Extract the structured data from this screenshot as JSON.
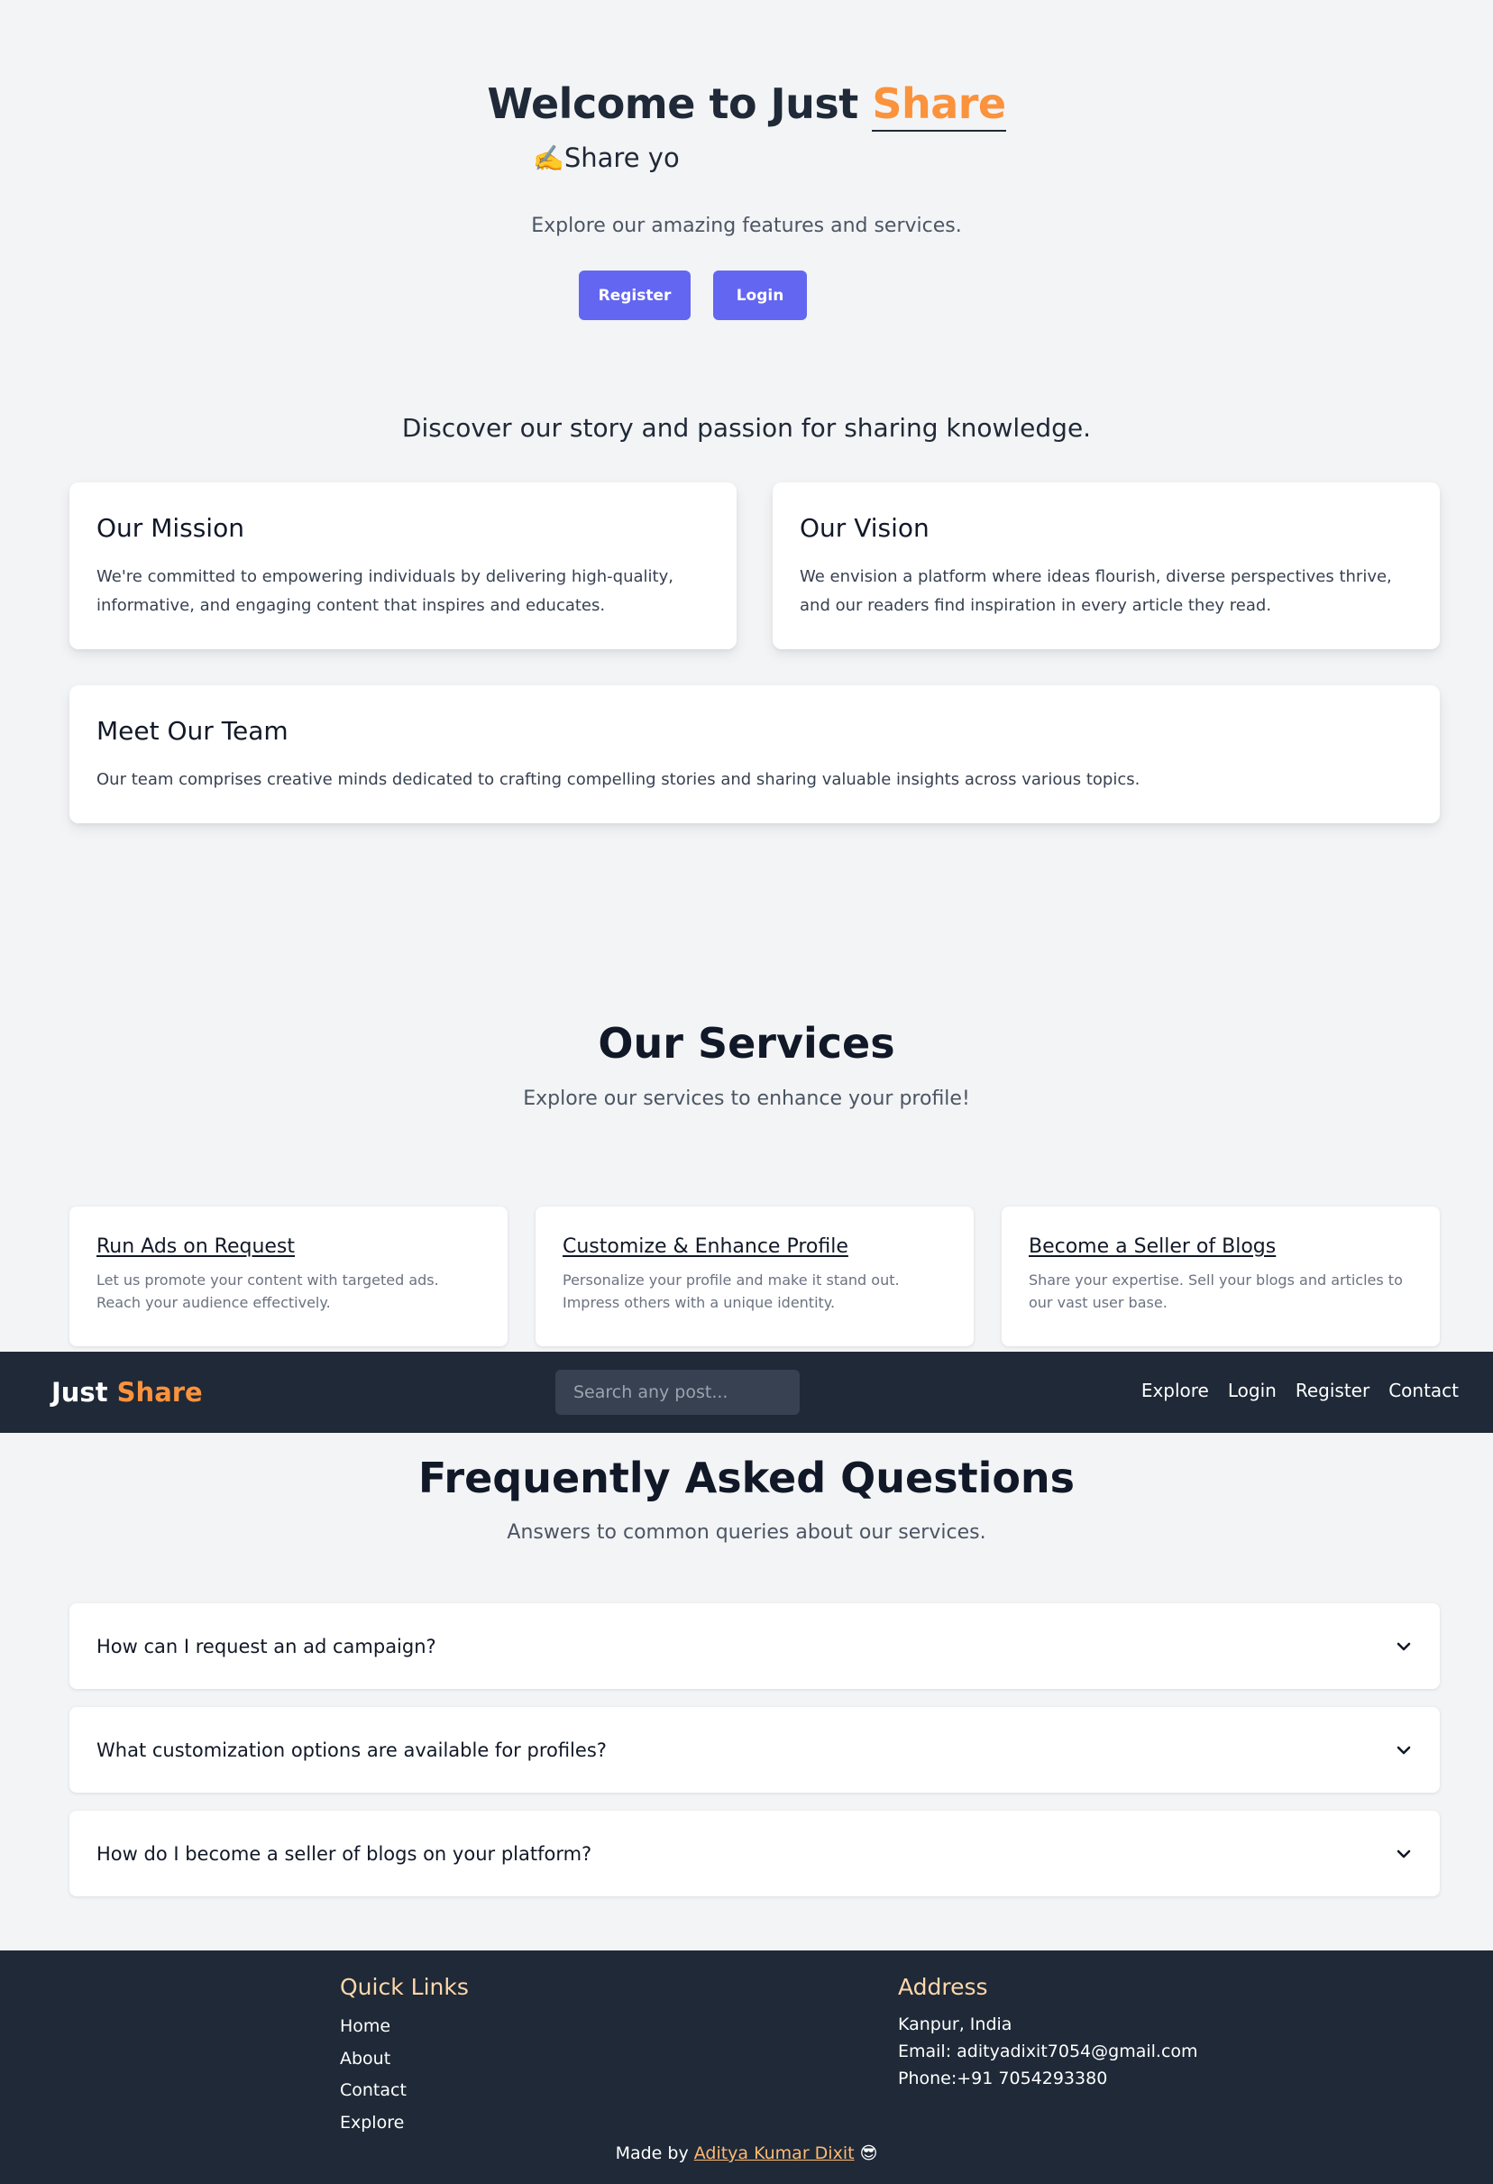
{
  "hero": {
    "title_prefix": "Welcome to Just ",
    "title_brand": "Share",
    "typing_emoji": "✍️",
    "typing_text": "Share yo",
    "subtitle": "Explore our amazing features and services.",
    "register_label": "Register",
    "login_label": "Login"
  },
  "about": {
    "heading": "Discover our story and passion for sharing knowledge.",
    "cards": [
      {
        "title": "Our Mission",
        "text": "We're committed to empowering individuals by delivering high-quality, informative, and engaging content that inspires and educates."
      },
      {
        "title": "Our Vision",
        "text": "We envision a platform where ideas flourish, diverse perspectives thrive, and our readers find inspiration in every article they read."
      },
      {
        "title": "Meet Our Team",
        "text": "Our team comprises creative minds dedicated to crafting compelling stories and sharing valuable insights across various topics."
      }
    ]
  },
  "services": {
    "heading": "Our Services",
    "subtitle": "Explore our services to enhance your profile!",
    "items": [
      {
        "title": "Run Ads on Request",
        "text": "Let us promote your content with targeted ads. Reach your audience effectively."
      },
      {
        "title": "Customize & Enhance Profile",
        "text": "Personalize your profile and make it stand out. Impress others with a unique identity."
      },
      {
        "title": "Become a Seller of Blogs",
        "text": "Share your expertise. Sell your blogs and articles to our vast user base."
      }
    ]
  },
  "navbar": {
    "logo_prefix": "Just ",
    "logo_brand": "Share",
    "search_placeholder": "Search any post...",
    "search_value": "",
    "links": [
      "Explore",
      "Login",
      "Register",
      "Contact"
    ]
  },
  "faq": {
    "heading": "Frequently Asked Questions",
    "subtitle": "Answers to common queries about our services.",
    "items": [
      {
        "question": "How can I request an ad campaign?",
        "icon": "chevron-down-icon"
      },
      {
        "question": "What customization options are available for profiles?",
        "icon": "chevron-down-icon"
      },
      {
        "question": "How do I become a seller of blogs on your platform?",
        "icon": "chevron-down-icon"
      }
    ]
  },
  "footer": {
    "quick_links_heading": "Quick Links",
    "quick_links": [
      "Home",
      "About",
      "Contact",
      "Explore"
    ],
    "address_heading": "Address",
    "address_lines": [
      "Kanpur, India",
      "Email: adityadixit7054@gmail.com",
      "Phone:+91 7054293380"
    ],
    "made_by_prefix": "Made by ",
    "author": "Aditya Kumar Dixit",
    "made_by_emoji": "😎"
  },
  "colors": {
    "brand_orange": "#fb923c",
    "button_indigo": "#6366f1",
    "nav_bg": "#1f2937",
    "footer_heading": "#fed7aa",
    "footer_link": "#fdba74",
    "page_bg": "#f3f4f6"
  }
}
